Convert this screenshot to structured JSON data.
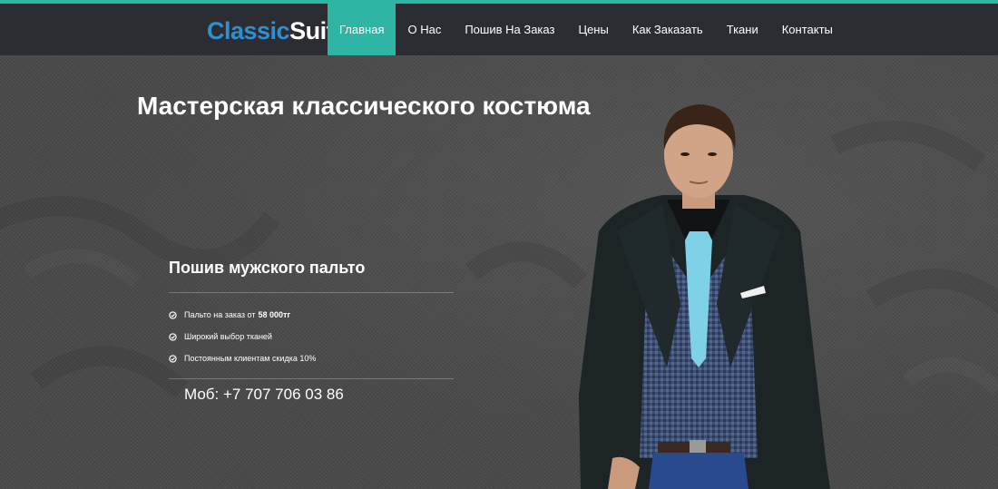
{
  "brand": {
    "logo_part1": "Classic",
    "logo_part2": "Suit",
    "logo_sub": "",
    "accent_color": "#2fb5a3",
    "logo_color": "#2f8fd0"
  },
  "nav": {
    "items": [
      {
        "label": "Главная",
        "active": true
      },
      {
        "label": "О Нас",
        "active": false
      },
      {
        "label": "Пошив На Заказ",
        "active": false
      },
      {
        "label": "Цены",
        "active": false
      },
      {
        "label": "Как Заказать",
        "active": false
      },
      {
        "label": "Ткани",
        "active": false
      },
      {
        "label": "Контакты",
        "active": false
      }
    ]
  },
  "hero": {
    "title": "Мастерская классического костюма"
  },
  "offer": {
    "title": "Пошив мужского пальто",
    "items": [
      {
        "text": "Пальто на заказ от",
        "strong": "58 000тг",
        "icon": "check-circle-icon"
      },
      {
        "text": "Широкий выбор тканей",
        "strong": "",
        "icon": "check-circle-icon"
      },
      {
        "text": "Постоянным клиентам скидка 10%",
        "strong": "",
        "icon": "check-circle-icon"
      }
    ],
    "phone": "Моб: +7 707 706 03 86"
  }
}
